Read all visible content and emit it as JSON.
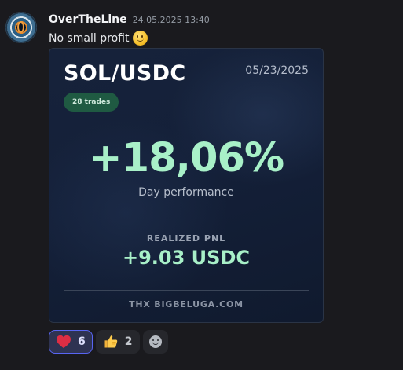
{
  "message": {
    "username": "OverTheLine",
    "timestamp": "24.05.2025 13:40",
    "text": "No small profit",
    "emoji": "slightly-smiling-face"
  },
  "card": {
    "pair": "SOL/USDC",
    "date": "05/23/2025",
    "trades_badge": "28 trades",
    "performance": "+18,06%",
    "performance_label": "Day performance",
    "pnl_label": "REALIZED PNL",
    "pnl_value": "+9.03 USDC",
    "footer": "THX BIGBELUGA.COM",
    "colors": {
      "background": "#142039",
      "positive": "#a8f0c8",
      "badge": "#1f5a42"
    }
  },
  "reactions": [
    {
      "icon": "heart-icon",
      "count": "6",
      "active": true
    },
    {
      "icon": "thumbs-up-icon",
      "count": "2",
      "active": false
    }
  ],
  "add_reaction_icon": "add-reaction-icon"
}
